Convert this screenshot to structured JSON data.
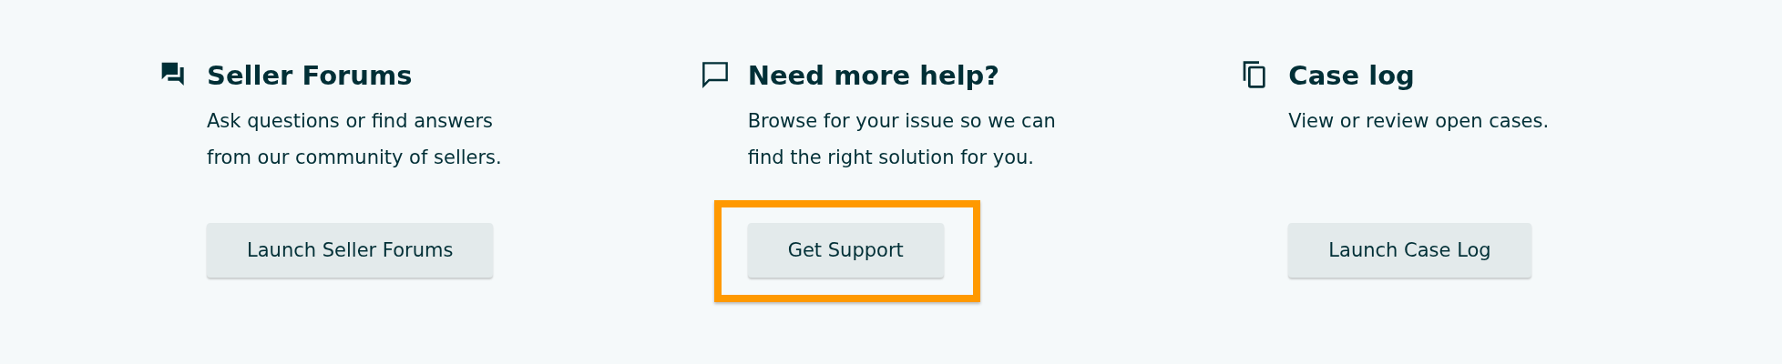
{
  "help_cards": [
    {
      "title": "Seller Forums",
      "description": "Ask questions or find answers from our community of sellers.",
      "button": "Launch Seller Forums",
      "highlighted": false
    },
    {
      "title": "Need more help?",
      "description": "Browse for your issue so we can find the right solution for you.",
      "button": "Get Support",
      "highlighted": true
    },
    {
      "title": "Case log",
      "description": "View or review open cases.",
      "button": "Launch Case Log",
      "highlighted": false
    }
  ]
}
